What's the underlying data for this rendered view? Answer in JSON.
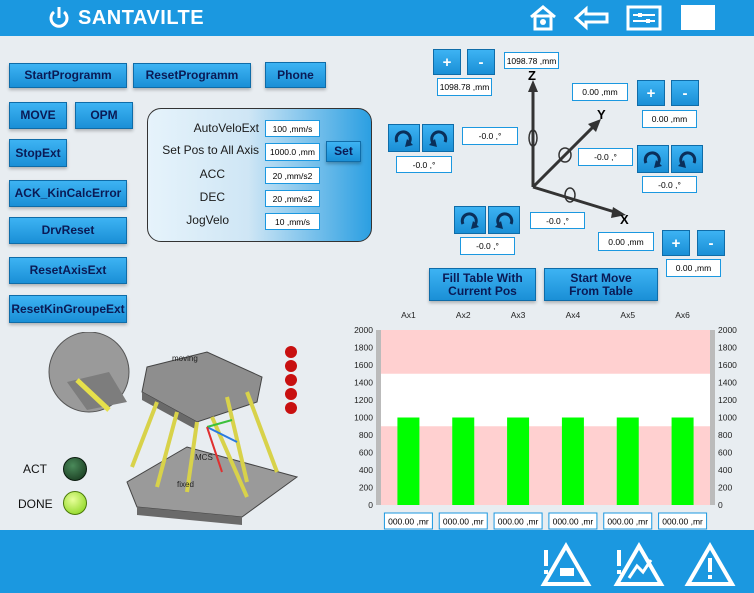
{
  "brand": {
    "name": "SANTAVILTE"
  },
  "header_icons": [
    "home-icon",
    "back-arrow-icon",
    "settings-panel-icon",
    "blank-square-icon"
  ],
  "left_buttons": {
    "start_program": "StartProgramm",
    "reset_program": "ResetProgramm",
    "phone": "Phone",
    "move": "MOVE",
    "opm": "OPM",
    "stop_ext": "StopExt",
    "ack_kin": "ACK_KinCalcError",
    "drv_reset": "DrvReset",
    "reset_axis": "ResetAxisExt",
    "reset_kin_group": "ResetKinGroupeExt"
  },
  "params": {
    "auto_velo_label": "AutoVeloExt",
    "auto_velo_value": "100 ,mm/s",
    "set_pos_label": "Set Pos to All Axis",
    "set_pos_value": "1000.0 ,mm",
    "set_label": "Set",
    "acc_label": "ACC",
    "acc_value": "20 ,mm/s2",
    "dec_label": "DEC",
    "dec_value": "20 ,mm/s2",
    "jog_label": "JogVelo",
    "jog_value": "10 ,mm/s"
  },
  "coords": {
    "z_target": "1098.78 ,mm",
    "z_actual": "1098.78 ,mm",
    "y_target": "0.00 ,mm",
    "y_actual": "0.00 ,mm",
    "x_target": "0.00 ,mm",
    "x_actual": "0.00 ,mm",
    "rz_target": "-0.0 ,°",
    "rz_actual": "-0.0 ,°",
    "ry_target": "-0.0 ,°",
    "ry_actual": "-0.0 ,°",
    "rx_target": "-0.0 ,°",
    "rx_actual": "-0.0 ,°",
    "plus": "+",
    "minus": "-",
    "axis_x": "X",
    "axis_y": "Y",
    "axis_z": "Z"
  },
  "table_buttons": {
    "fill": "Fill Table With Current Pos",
    "start": "Start Move From Table"
  },
  "status": {
    "act_label": "ACT",
    "done_label": "DONE",
    "act_color": "#1e4a2a",
    "done_color": "#8fe010"
  },
  "chart_data": {
    "type": "bar",
    "categories": [
      "Ax1",
      "Ax2",
      "Ax3",
      "Ax4",
      "Ax5",
      "Ax6"
    ],
    "values": [
      1000,
      1000,
      1000,
      1000,
      1000,
      1000
    ],
    "ylim": [
      0,
      2000
    ],
    "yticks": [
      "2000",
      "1800",
      "1600",
      "1400",
      "1200",
      "1000",
      "800",
      "600",
      "400",
      "200",
      "0"
    ],
    "bar_color": "#00ff00",
    "upper_band": [
      1500,
      2000
    ],
    "lower_band": [
      0,
      900
    ],
    "band_color": "#ffd0d0",
    "inputs": [
      "000.00 ,mr",
      "000.00 ,mr",
      "000.00 ,mr",
      "000.00 ,mr",
      "000.00 ,mr",
      "000.00 ,mr"
    ]
  },
  "diagram": {
    "moving": "moving",
    "mcs": "MCS",
    "fixed": "fixed",
    "z": "z",
    "x": "x",
    "y": "y"
  },
  "footer_icons": [
    "warning-drive-icon",
    "warning-motion-icon",
    "warning-icon"
  ]
}
